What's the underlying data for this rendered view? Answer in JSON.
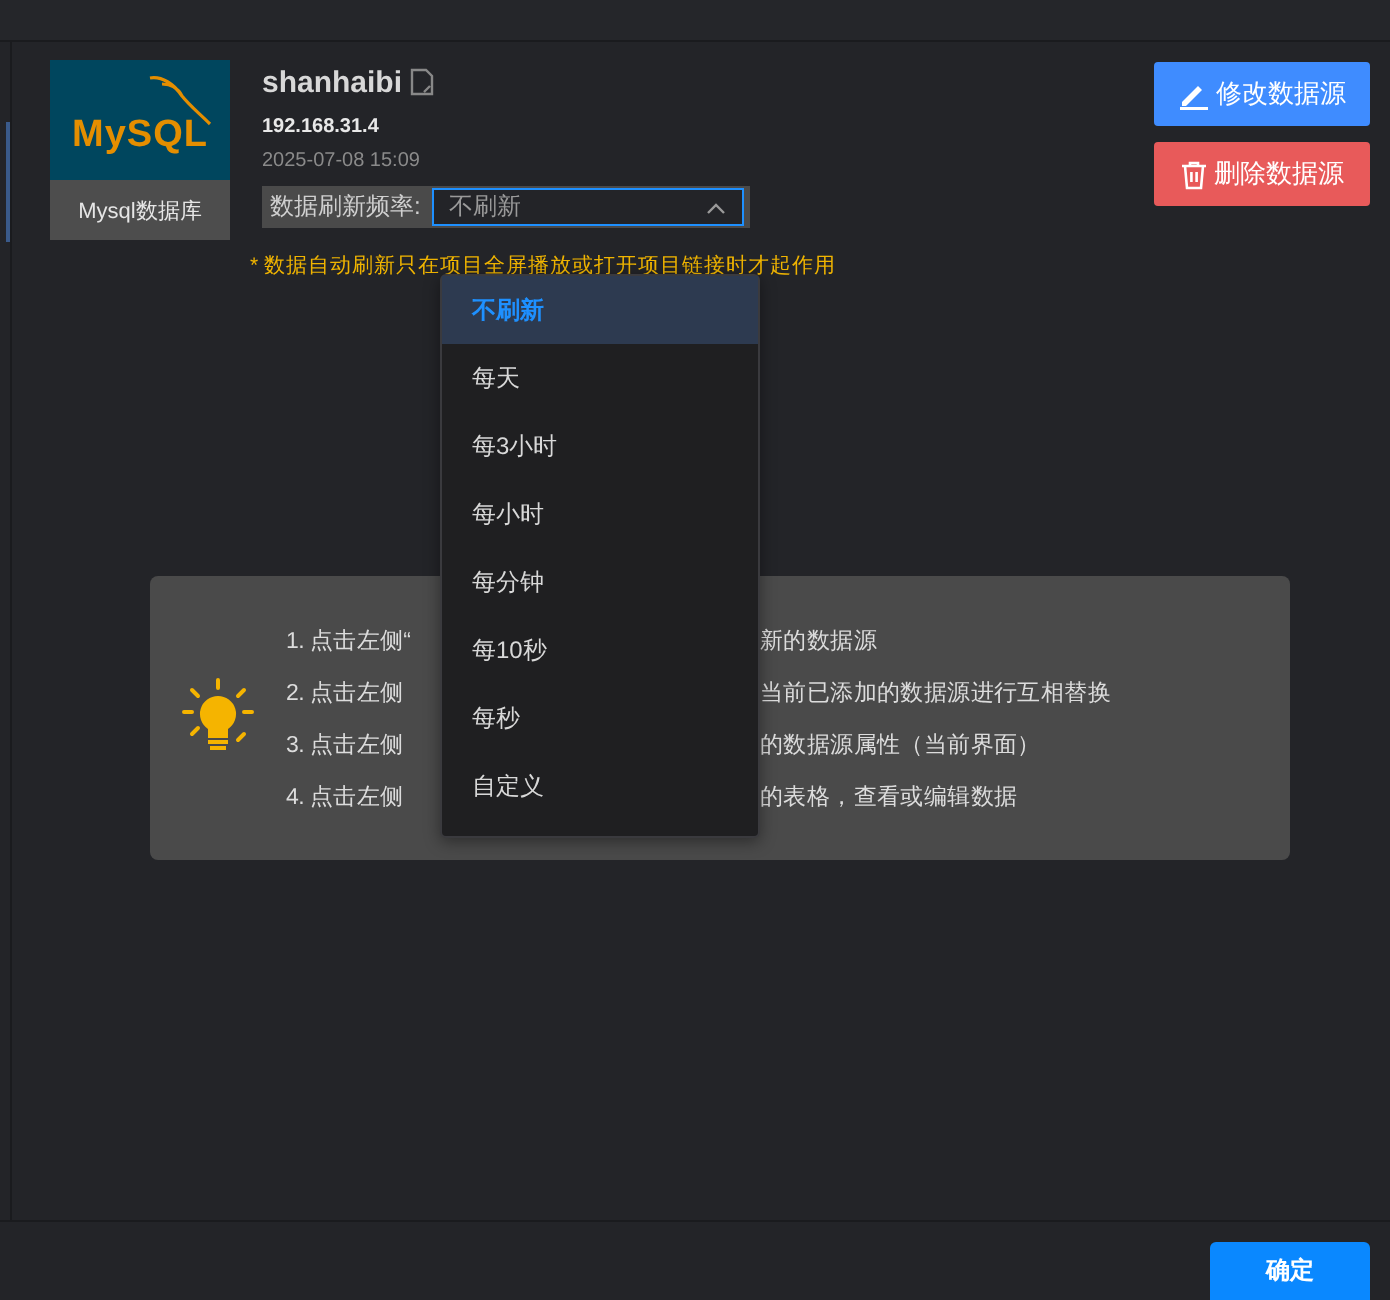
{
  "source": {
    "logo_text": "MySQL",
    "logo_label": "Mysql数据库",
    "name": "shanhaibi",
    "host": "192.168.31.4",
    "updated": "2025-07-08 15:09"
  },
  "refresh": {
    "label": "数据刷新频率:",
    "value": "不刷新",
    "open": true,
    "note": "* 数据自动刷新只在项目全屏播放或打开项目链接时才起作用",
    "options": [
      {
        "label": "不刷新",
        "selected": true
      },
      {
        "label": "每天",
        "selected": false
      },
      {
        "label": "每3小时",
        "selected": false
      },
      {
        "label": "每小时",
        "selected": false
      },
      {
        "label": "每分钟",
        "selected": false
      },
      {
        "label": "每10秒",
        "selected": false
      },
      {
        "label": "每秒",
        "selected": false
      },
      {
        "label": "自定义",
        "selected": false
      }
    ]
  },
  "actions": [
    {
      "kind": "edit",
      "label": "修改数据源"
    },
    {
      "kind": "delete",
      "label": "删除数据源"
    }
  ],
  "tips": [
    {
      "before": "1. 点击左侧“",
      "after": "新的数据源"
    },
    {
      "before": "2. 点击左侧",
      "after": "当前已添加的数据源进行互相替换"
    },
    {
      "before": "3. 点击左侧",
      "after": "的数据源属性（当前界面）"
    },
    {
      "before": "4. 点击左侧",
      "after": "的表格，查看或编辑数据"
    }
  ],
  "footer": {
    "confirm": "确定"
  }
}
